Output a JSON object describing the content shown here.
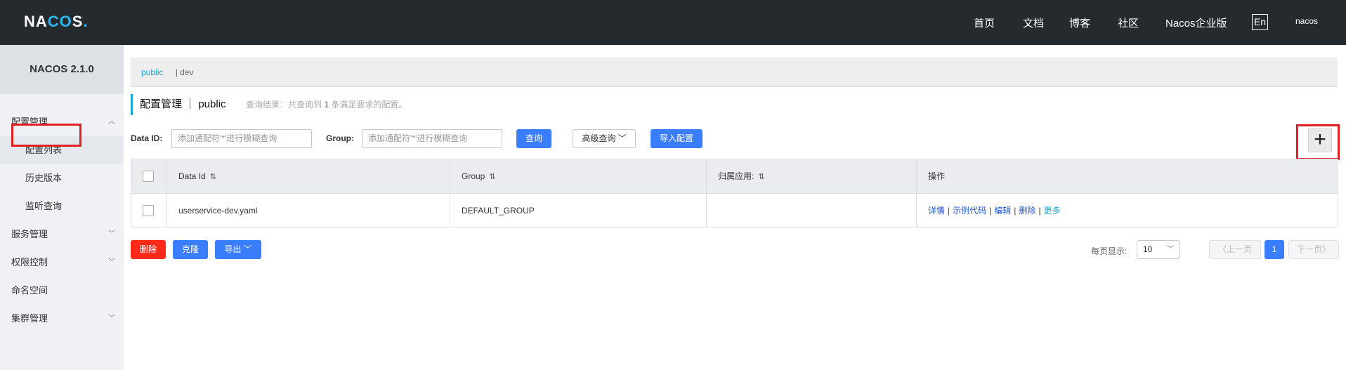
{
  "topbar": {
    "logo": "NACOS.",
    "nav": [
      "首页",
      "文档",
      "博客",
      "社区",
      "Nacos企业版"
    ],
    "lang": "En",
    "user": "nacos"
  },
  "sidebar": {
    "version": "NACOS 2.1.0",
    "items": [
      {
        "label": "配置管理"
      },
      {
        "label": "配置列表"
      },
      {
        "label": "历史版本"
      },
      {
        "label": "监听查询"
      },
      {
        "label": "服务管理"
      },
      {
        "label": "权限控制"
      },
      {
        "label": "命名空间"
      },
      {
        "label": "集群管理"
      }
    ]
  },
  "namespaces": {
    "active": "public",
    "other": "| dev"
  },
  "title": {
    "main": "配置管理 ｜ public",
    "hint_prefix": "查询结果：共查询到",
    "hint_count": "1",
    "hint_suffix": "条满足要求的配置。"
  },
  "search": {
    "dataid_label": "Data ID:",
    "dataid_placeholder": "添加通配符'*'进行模糊查询",
    "group_label": "Group:",
    "group_placeholder": "添加通配符'*'进行模糊查询",
    "query_btn": "查询",
    "advanced_btn": "高级查询",
    "import_btn": "导入配置",
    "add_btn": "+"
  },
  "table": {
    "headers": [
      "Data Id",
      "Group",
      "归属应用:",
      "操作"
    ],
    "rows": [
      {
        "data_id": "userservice-dev.yaml",
        "group": "DEFAULT_GROUP",
        "app": ""
      }
    ],
    "ops": [
      "详情",
      "示例代码",
      "编辑",
      "删除",
      "更多"
    ]
  },
  "bulk": {
    "delete": "删除",
    "clone": "克隆",
    "export": "导出"
  },
  "pagination": {
    "per_page_label": "每页显示:",
    "per_page": "10",
    "prev": "上一页",
    "current": "1",
    "next": "下一页"
  }
}
